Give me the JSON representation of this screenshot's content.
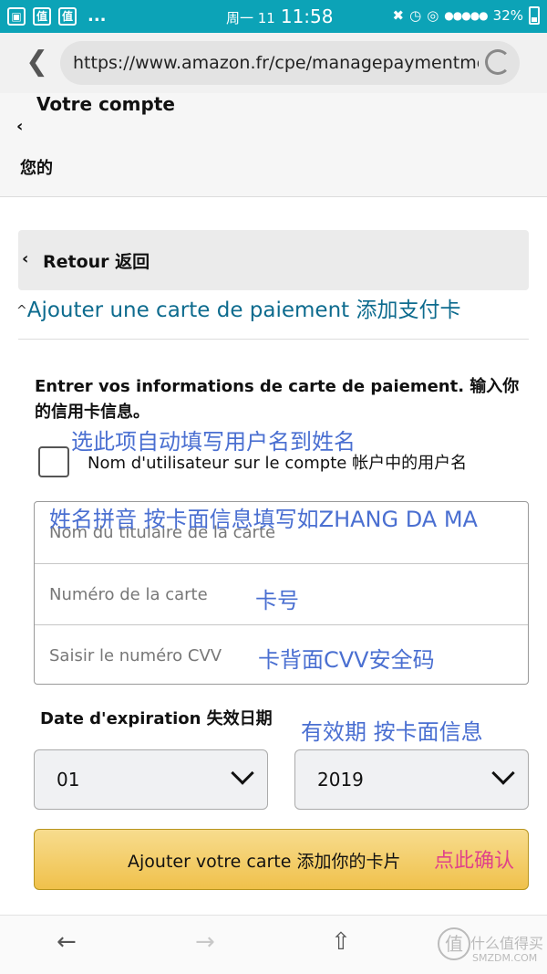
{
  "status_bar": {
    "time": "11:58",
    "weekday": "周一 11",
    "battery": "32%",
    "dots": "..."
  },
  "browser": {
    "url": "https://www.amazon.fr/cpe/managepaymentmet"
  },
  "account": {
    "title": "Votre compte",
    "subtitle": "您的"
  },
  "retour": {
    "label": "Retour 返回"
  },
  "add_card_heading": "Ajouter une carte de paiement 添加支付卡",
  "form": {
    "instructions": "Entrer vos informations de carte de paiement. 输入你的信用卡信息。",
    "checkbox_label": "Nom d'utilisateur sur le compte 帐户中的用户名",
    "fields": [
      {
        "placeholder": "Nom du titulaire de la carte"
      },
      {
        "placeholder": "Numéro de la carte"
      },
      {
        "placeholder": "Saisir le numéro CVV"
      }
    ],
    "expiration_label": "Date d'expiration 失效日期",
    "month_value": "01",
    "year_value": "2019",
    "submit_label": "Ajouter votre carte 添加你的卡片"
  },
  "annotations": {
    "checkbox_note": "选此项自动填写用户名到姓名",
    "name_note": "姓名拼音 按卡面信息填写如ZHANG DA MA",
    "card_note": "卡号",
    "cvv_note": "卡背面CVV安全码",
    "expiry_note": "有效期 按卡面信息",
    "confirm_note": "点此确认"
  },
  "watermark": {
    "logo_char": "值",
    "text": "什么值得买",
    "site": "SMZDM.COM"
  },
  "colors": {
    "status_bar": "#0ca3b7",
    "link": "#0d6b8e",
    "annotation": "#4a6fd1",
    "annotation_pink": "#e0428a",
    "button": "#f0c14b"
  }
}
